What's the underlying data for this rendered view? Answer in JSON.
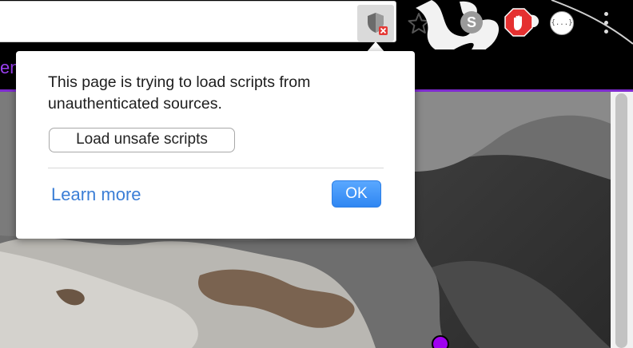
{
  "toolbar": {
    "shield_icon": "shield-blocked-icon",
    "bookmark_icon": "star-icon",
    "extensions": [
      {
        "name": "s-extension-icon",
        "label": "S"
      },
      {
        "name": "adblock-stop-icon"
      },
      {
        "name": "json-viewer-icon",
        "label": "{...}"
      }
    ],
    "menu_icon": "vertical-dots-icon"
  },
  "page": {
    "partial_text": "en",
    "accent_color": "#9a3ff0"
  },
  "popup": {
    "message": "This page is trying to load scripts from unauthenticated sources.",
    "load_button": "Load unsafe scripts",
    "learn_more": "Learn more",
    "ok": "OK",
    "link_color": "#3b7ed6",
    "ok_color": "#2f86f2"
  }
}
